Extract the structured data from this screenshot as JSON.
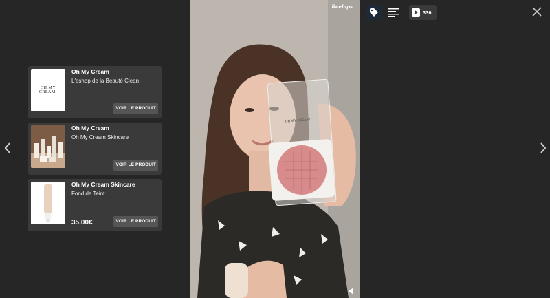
{
  "watermark": "Reelaps",
  "views": {
    "count": "336"
  },
  "products": [
    {
      "brand": "Oh My Cream",
      "name": "L'eshop de la Beauté Clean",
      "price": "",
      "cta": "VOIR LE PRODUIT",
      "logo": "OH MY CREAM!"
    },
    {
      "brand": "Oh My Cream",
      "name": "Oh My Cream Skincare",
      "price": "",
      "cta": "VOIR LE PRODUIT"
    },
    {
      "brand": "Oh My Cream Skincare",
      "name": "Fond de Teint",
      "price": "35.00€",
      "cta": "VOIR LE PRODUIT"
    }
  ],
  "compact_label": "OH MY CREAM!",
  "icons": {
    "prev": "chevron-left-icon",
    "next": "chevron-right-icon",
    "tag": "tag-icon",
    "list": "list-icon",
    "play": "play-icon",
    "close": "close-icon",
    "sound": "speaker-icon"
  },
  "colors": {
    "background": "#262626",
    "card": "#3a3a3a",
    "cta": "#555555"
  }
}
